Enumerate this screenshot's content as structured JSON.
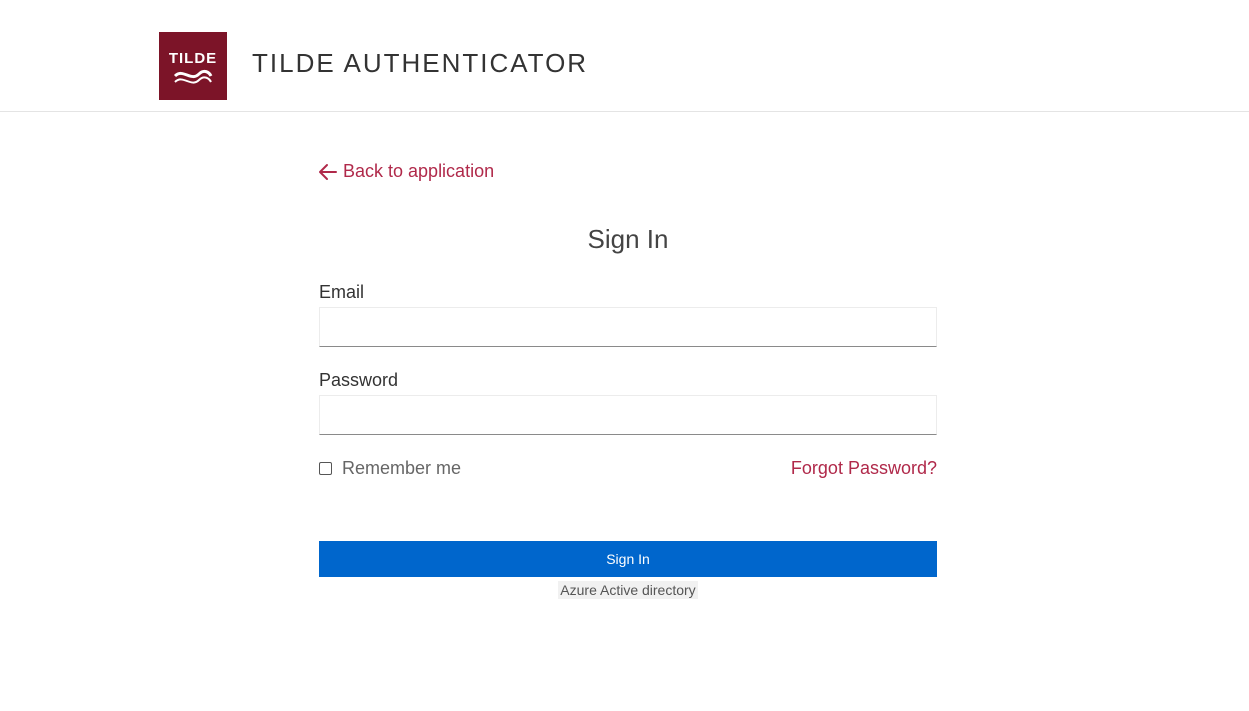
{
  "header": {
    "logo_text": "TILDE",
    "app_title": "TILDE AUTHENTICATOR"
  },
  "nav": {
    "back_label": "Back to application"
  },
  "form": {
    "title": "Sign In",
    "email_label": "Email",
    "email_value": "",
    "password_label": "Password",
    "password_value": "",
    "remember_label": "Remember me",
    "remember_checked": false,
    "forgot_label": "Forgot Password?",
    "submit_label": "Sign In",
    "external_provider": "Azure Active directory"
  },
  "colors": {
    "brand": "#7c1428",
    "link": "#b0294a",
    "primary_button": "#0066cc"
  },
  "icons": {
    "back": "arrow-left-icon",
    "logo": "tilde-logo"
  }
}
